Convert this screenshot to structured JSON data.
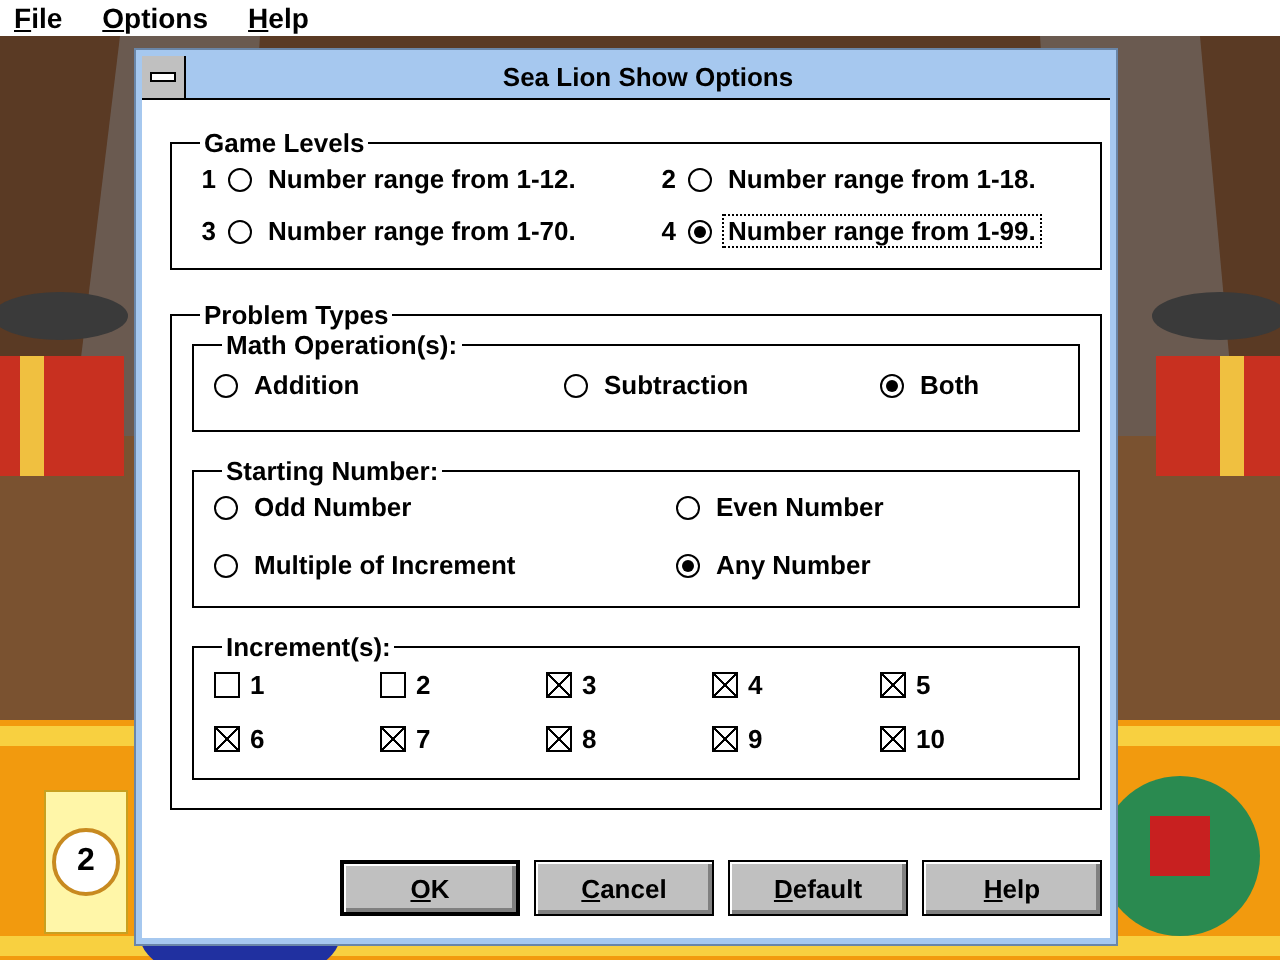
{
  "menu": [
    {
      "label": "File",
      "mnemonic": true
    },
    {
      "label": "Options",
      "mnemonic": true
    },
    {
      "label": "Help",
      "mnemonic": true
    }
  ],
  "dialog": {
    "title": "Sea Lion Show Options",
    "game_levels": {
      "label": "Game Levels",
      "options": [
        {
          "number": "1",
          "label": "Number range from 1-12.",
          "selected": false,
          "focused": false
        },
        {
          "number": "2",
          "label": "Number range from 1-18.",
          "selected": false,
          "focused": false
        },
        {
          "number": "3",
          "label": "Number range from 1-70.",
          "selected": false,
          "focused": false
        },
        {
          "number": "4",
          "label": "Number range from 1-99.",
          "selected": true,
          "focused": true
        }
      ]
    },
    "problem_types": {
      "label": "Problem Types",
      "math": {
        "label": "Math Operation(s):",
        "options": [
          {
            "label": "Addition",
            "selected": false
          },
          {
            "label": "Subtraction",
            "selected": false
          },
          {
            "label": "Both",
            "selected": true
          }
        ]
      },
      "starting": {
        "label": "Starting Number:",
        "options": [
          {
            "label": "Odd Number",
            "selected": false
          },
          {
            "label": "Even Number",
            "selected": false
          },
          {
            "label": "Multiple of Increment",
            "selected": false
          },
          {
            "label": "Any Number",
            "selected": true
          }
        ]
      },
      "increments": {
        "label": "Increment(s):",
        "options": [
          {
            "label": "1",
            "checked": false
          },
          {
            "label": "2",
            "checked": false
          },
          {
            "label": "3",
            "checked": true
          },
          {
            "label": "4",
            "checked": true
          },
          {
            "label": "5",
            "checked": true
          },
          {
            "label": "6",
            "checked": true
          },
          {
            "label": "7",
            "checked": true
          },
          {
            "label": "8",
            "checked": true
          },
          {
            "label": "9",
            "checked": true
          },
          {
            "label": "10",
            "checked": true
          }
        ]
      }
    },
    "buttons": [
      {
        "label": "OK",
        "mnemonic": true,
        "default": true
      },
      {
        "label": "Cancel",
        "mnemonic": true,
        "default": false
      },
      {
        "label": "Default",
        "mnemonic": true,
        "default": false
      },
      {
        "label": "Help",
        "mnemonic": true,
        "default": false
      }
    ]
  },
  "ticket": {
    "number": "2"
  }
}
